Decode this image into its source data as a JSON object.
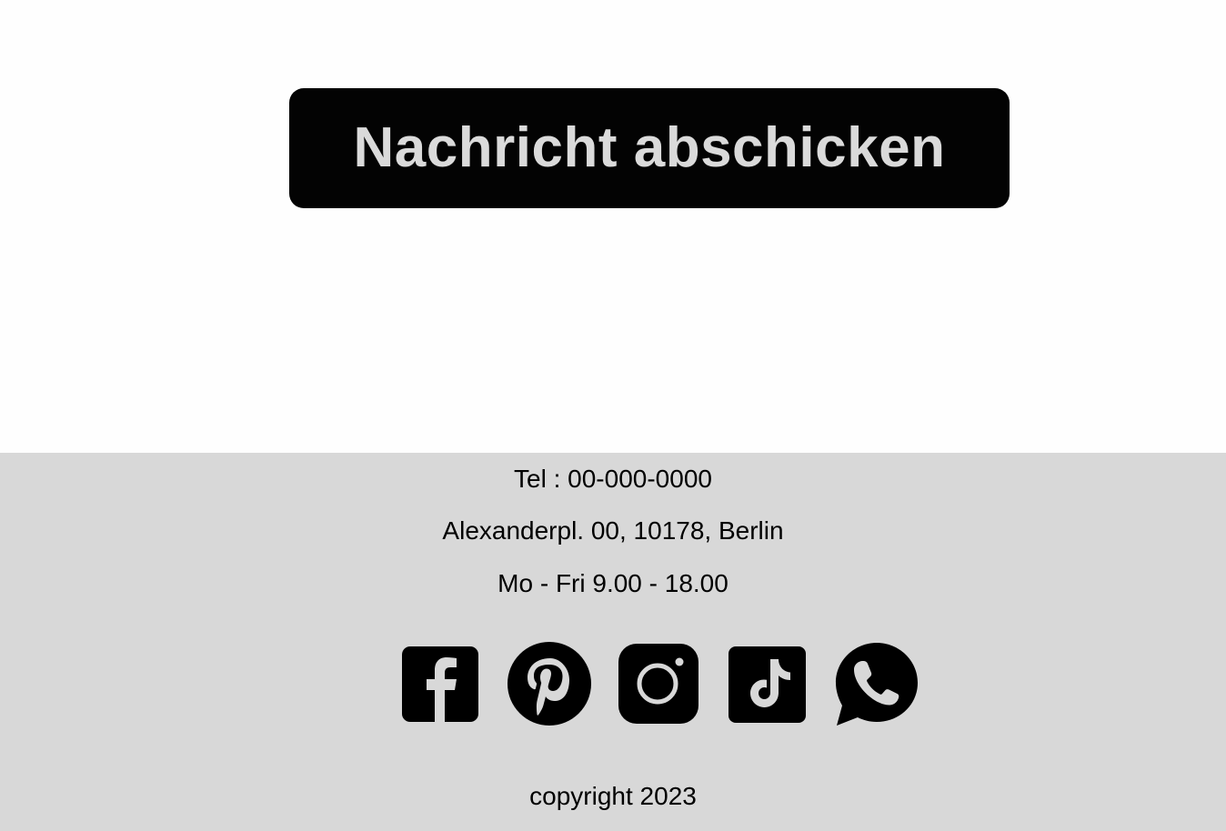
{
  "form": {
    "submit_label": "Nachricht abschicken"
  },
  "footer": {
    "tel": "Tel : 00-000-0000",
    "address": "Alexanderpl. 00, 10178, Berlin",
    "hours": "Mo - Fri 9.00 - 18.00",
    "copyright": "copyright 2023",
    "social_icons": [
      "facebook-icon",
      "pinterest-icon",
      "instagram-icon",
      "tiktok-icon",
      "whatsapp-icon"
    ]
  },
  "colors": {
    "button_bg": "#030303",
    "button_text": "#dadada",
    "footer_bg": "#d8d8d8",
    "page_bg": "#fefefe"
  }
}
